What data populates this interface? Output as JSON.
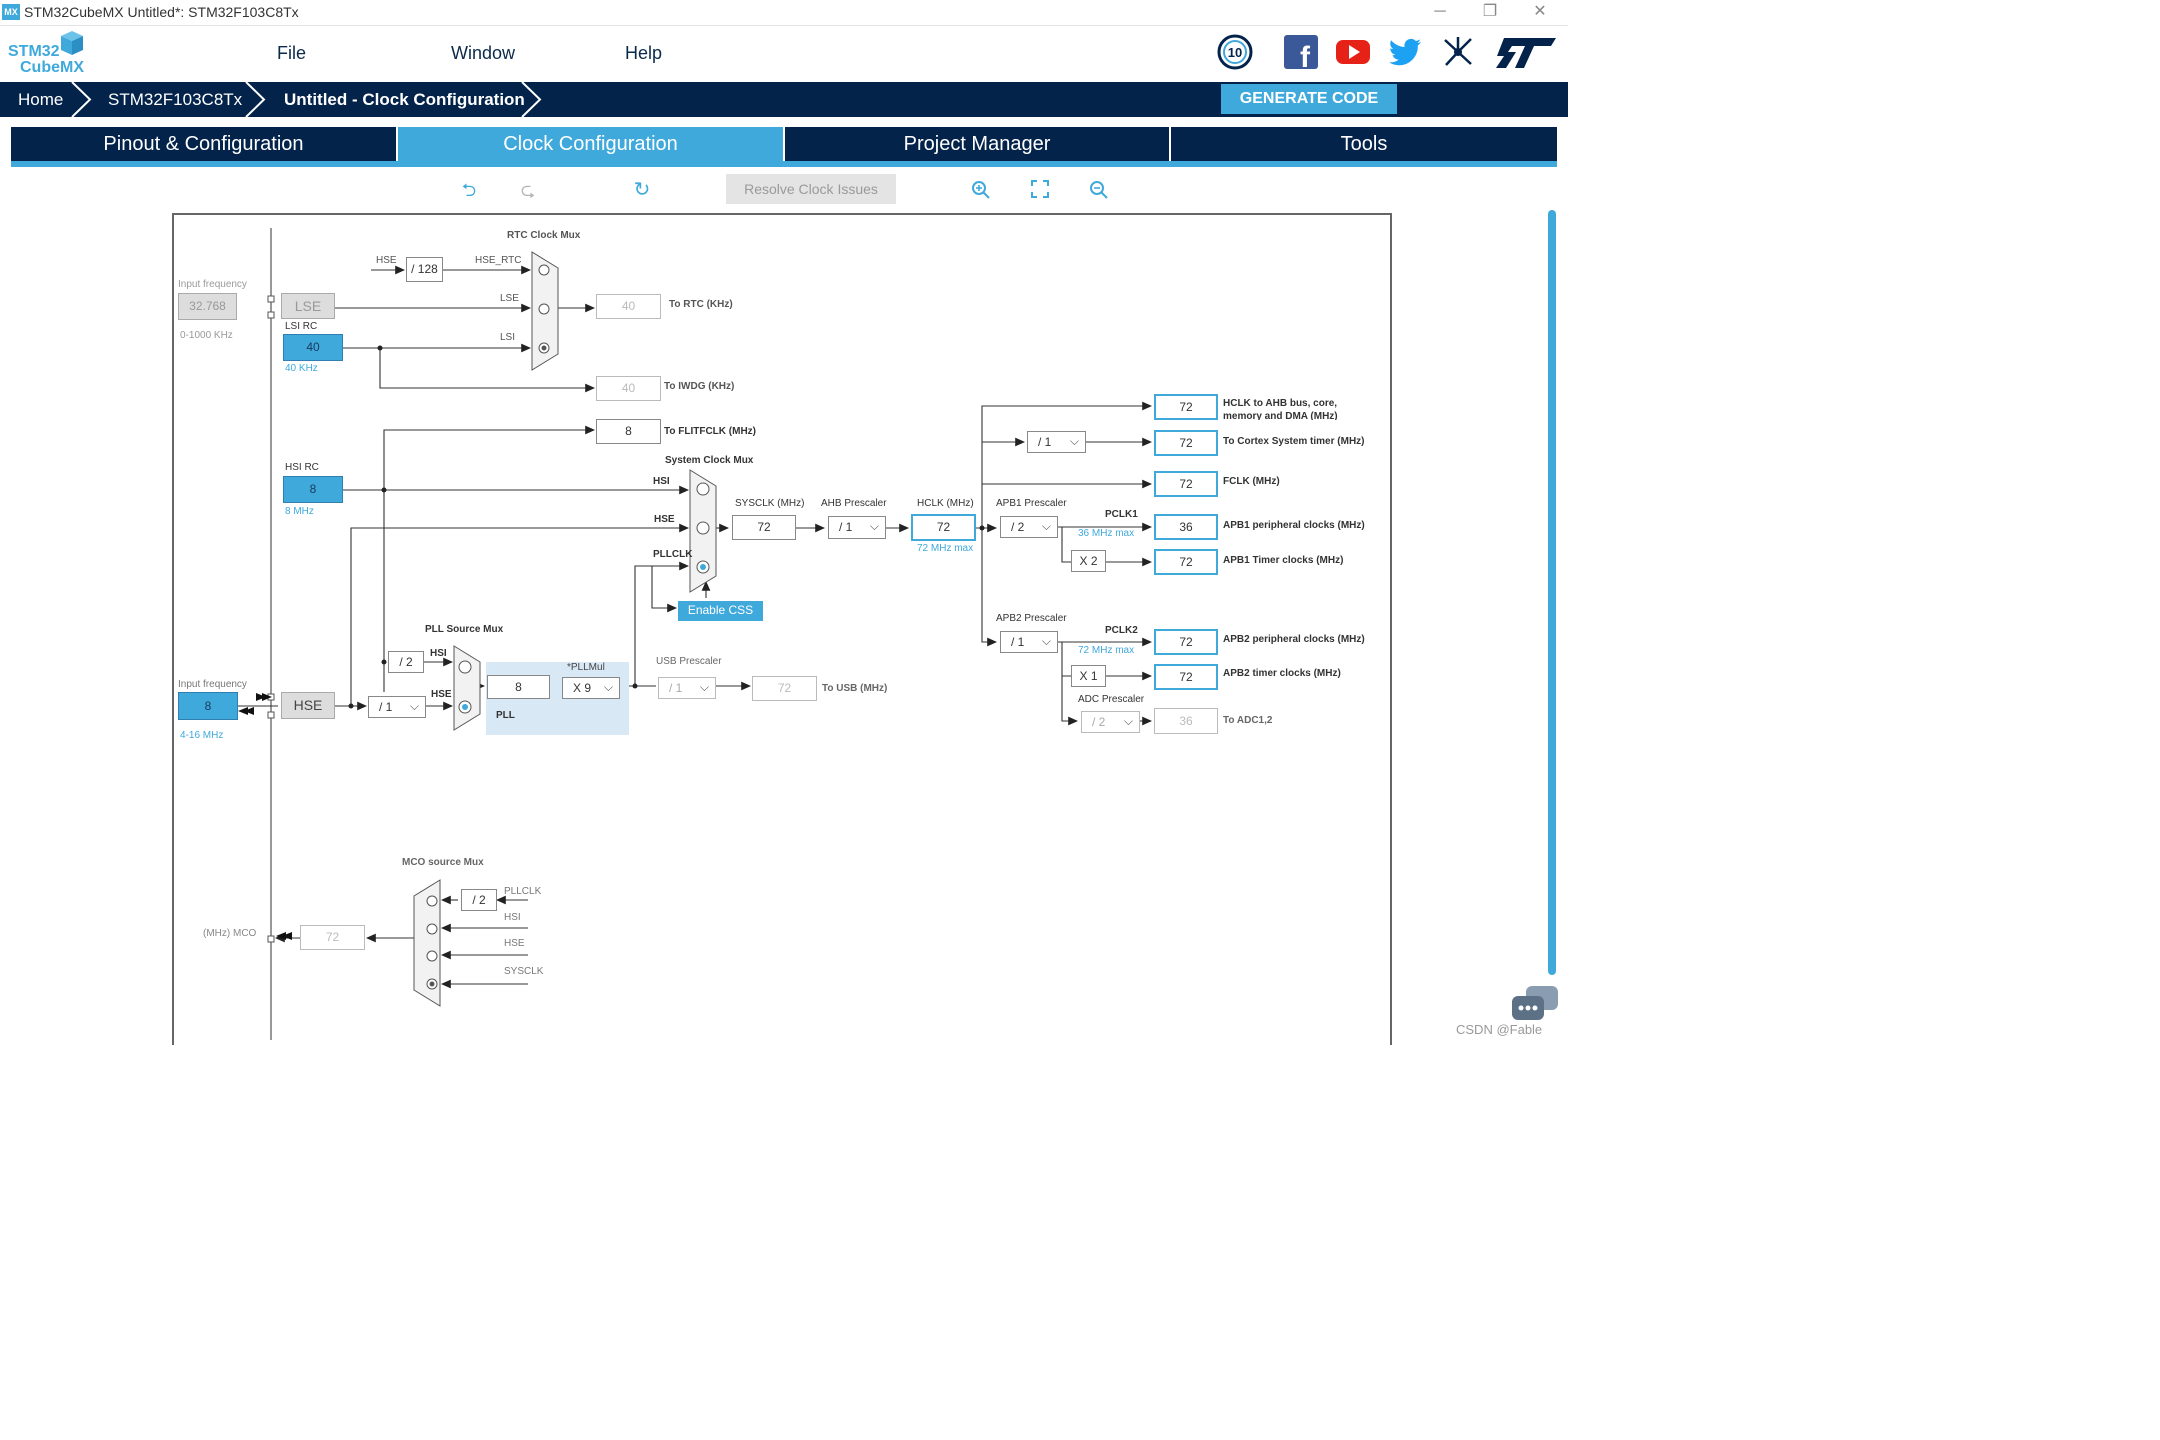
{
  "window": {
    "title": "STM32CubeMX Untitled*: STM32F103C8Tx",
    "app_icon_text": "MX"
  },
  "menu": {
    "logo_top": "STM32",
    "logo_bottom": "CubeMX",
    "items": [
      "File",
      "Window",
      "Help"
    ]
  },
  "social_icons": [
    "anniversary-10-badge",
    "facebook",
    "youtube",
    "twitter",
    "network",
    "st-logo"
  ],
  "breadcrumb": [
    "Home",
    "STM32F103C8Tx",
    "Untitled - Clock Configuration"
  ],
  "generate_code": "GENERATE CODE",
  "tabs": [
    "Pinout & Configuration",
    "Clock Configuration",
    "Project Manager",
    "Tools"
  ],
  "active_tab": "Clock Configuration",
  "toolbar": {
    "resolve": "Resolve Clock Issues",
    "icons": [
      "undo",
      "redo",
      "reset",
      "zoom-in",
      "fit",
      "zoom-out"
    ]
  },
  "clock": {
    "lse_input_label": "Input frequency",
    "lse_input_value": "32.768",
    "lse_range": "0-1000 KHz",
    "lse_label": "LSE",
    "lsi_label": "LSI RC",
    "lsi_value": "40",
    "lsi_note": "40 KHz",
    "rtc_mux_title": "RTC Clock Mux",
    "hse": "HSE",
    "div128": "/ 128",
    "hse_rtc": "HSE_RTC",
    "lse_small": "LSE",
    "lsi_small": "LSI",
    "rtc_value": "40",
    "rtc_label": "To RTC (KHz)",
    "iwdg_value": "40",
    "iwdg_label": "To IWDG (KHz)",
    "flit_value": "8",
    "flit_label": "To FLITFCLK (MHz)",
    "hsi_rc_label": "HSI RC",
    "hsi_value": "8",
    "hsi_note": "8 MHz",
    "sysmux_title": "System Clock Mux",
    "hsi": "HSI",
    "pllclk": "PLLCLK",
    "sysclk_label": "SYSCLK (MHz)",
    "sysclk_value": "72",
    "ahb_label": "AHB Prescaler",
    "ahb_value": "/ 1",
    "hclk_label": "HCLK (MHz)",
    "hclk_value": "72",
    "hclk_max": "72 MHz max",
    "enable_css": "Enable CSS",
    "pll_src_title": "PLL Source Mux",
    "div2": "/ 2",
    "hse_input_label": "Input frequency",
    "hse_input_value": "8",
    "hse_range": "4-16 MHz",
    "hse_div": "/ 1",
    "pll_in_value": "8",
    "pllmul_label": "*PLLMul",
    "pllmul_value": "X 9",
    "pll_label": "PLL",
    "usb_label": "USB Prescaler",
    "usb_div": "/ 1",
    "usb_value": "72",
    "usb_out": "To USB (MHz)",
    "ahb_out": [
      {
        "value": "72",
        "label": "HCLK to AHB bus, core,",
        "label2": "memory and DMA (MHz)"
      },
      {
        "value": "72",
        "label": "To Cortex System timer (MHz)"
      },
      {
        "value": "72",
        "label": "FCLK (MHz)"
      }
    ],
    "cortex_div": "/ 1",
    "apb1_label": "APB1 Prescaler",
    "apb1_value": "/ 2",
    "pclk1": "PCLK1",
    "pclk1_max": "36 MHz max",
    "apb1_periph_value": "36",
    "apb1_periph_label": "APB1 peripheral clocks (MHz)",
    "apb1_x": "X 2",
    "apb1_timer_value": "72",
    "apb1_timer_label": "APB1 Timer clocks (MHz)",
    "apb2_label": "APB2 Prescaler",
    "apb2_value": "/ 1",
    "pclk2": "PCLK2",
    "pclk2_max": "72 MHz max",
    "apb2_periph_value": "72",
    "apb2_periph_label": "APB2 peripheral clocks (MHz)",
    "apb2_x": "X 1",
    "apb2_timer_value": "72",
    "apb2_timer_label": "APB2 timer clocks (MHz)",
    "adc_label": "ADC Prescaler",
    "adc_div": "/ 2",
    "adc_value": "36",
    "adc_out": "To ADC1,2",
    "mco_title": "MCO source Mux",
    "mco_label": "(MHz) MCO",
    "mco_value": "72",
    "mco_div": "/ 2",
    "mco_sources": [
      "PLLCLK",
      "HSI",
      "HSE",
      "SYSCLK"
    ]
  },
  "colors": {
    "navy": "#03234b",
    "accent": "#3fa9dc",
    "grey_text": "#999999"
  },
  "watermark": "CSDN @Fable"
}
